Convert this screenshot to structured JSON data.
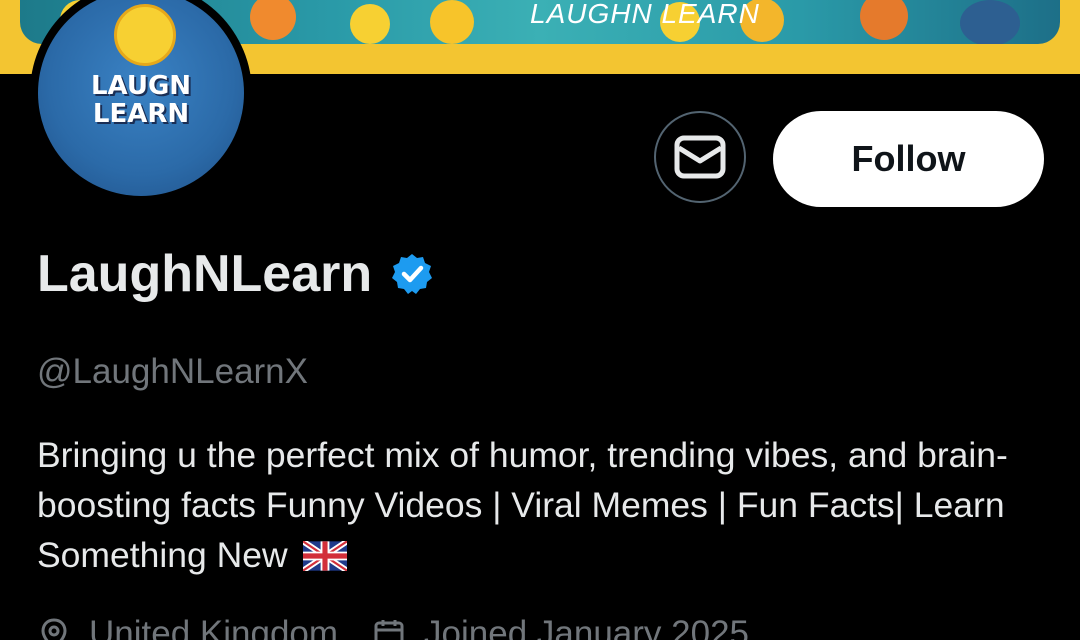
{
  "banner": {
    "title": "LAUGHN LEARN"
  },
  "avatar": {
    "line1": "LAUGN",
    "line2": "LEARN"
  },
  "profile": {
    "display_name": "LaughNLearn",
    "handle": "@LaughNLearnX",
    "bio": "Bringing u the perfect mix of humor, trending vibes, and brain-boosting facts Funny Videos | Viral Memes | Fun Facts| Learn Something New",
    "location": "United Kingdom",
    "joined": "Joined January 2025"
  },
  "actions": {
    "follow_label": "Follow"
  },
  "icons": {
    "message": "envelope-icon",
    "verified": "verified-badge-icon",
    "location": "location-pin-icon",
    "calendar": "calendar-icon",
    "flag": "uk-flag-icon"
  },
  "colors": {
    "background": "#000000",
    "primary_text": "#e7e9ea",
    "secondary_text": "#71767b",
    "verified_blue": "#1d9bf0",
    "follow_bg": "#ffffff",
    "banner_accent": "#f3c531"
  }
}
